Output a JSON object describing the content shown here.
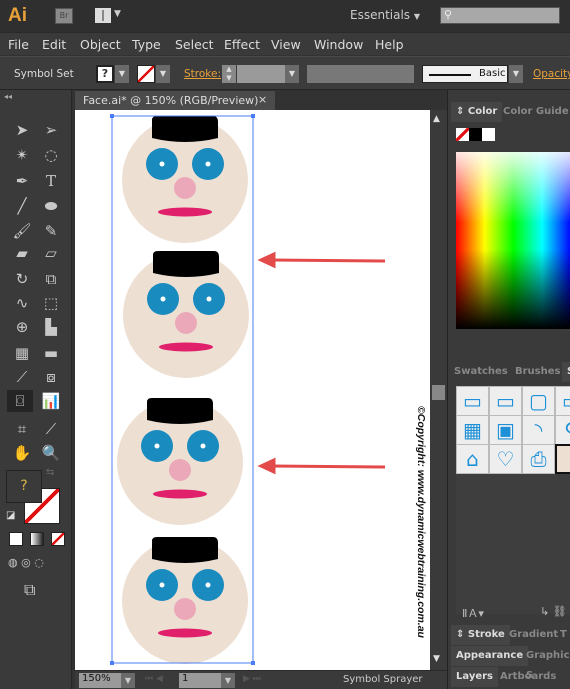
{
  "app": {
    "logo": "Ai",
    "bridge": "Br",
    "workspace": "Essentials",
    "search_placeholder": ""
  },
  "menu": [
    "File",
    "Edit",
    "Object",
    "Type",
    "Select",
    "Effect",
    "View",
    "Window",
    "Help"
  ],
  "control": {
    "selection_label": "Symbol Set",
    "fill_icon": "?",
    "stroke_label": "Stroke:",
    "brush_label": "Basic",
    "opacity_label": "Opacity"
  },
  "document": {
    "tab_title": "Face.ai* @ 150% (RGB/Preview)",
    "close": "×",
    "copyright": "©Copyright: www.dynamicwebtraining.com.au"
  },
  "status": {
    "zoom": "150%",
    "artboard": "1",
    "tool": "Symbol Sprayer"
  },
  "panels": {
    "color_tabs": [
      "Color",
      "Color Guide"
    ],
    "symbol_tabs": [
      "Swatches",
      "Brushes",
      "S"
    ],
    "stroke_tabs": [
      "Stroke",
      "Gradient",
      "T"
    ],
    "appearance_tabs": [
      "Appearance",
      "Graphic S"
    ],
    "layer_tabs": [
      "Layers",
      "Artboards"
    ]
  },
  "colors": {
    "accent_orange": "#e8a13a",
    "skin": "#ede0d3",
    "eye": "#1a8bbf",
    "nose": "#eba8b8",
    "mouth": "#e0206a",
    "arrow": "#e34a4a",
    "selection": "#4a7cf5"
  }
}
